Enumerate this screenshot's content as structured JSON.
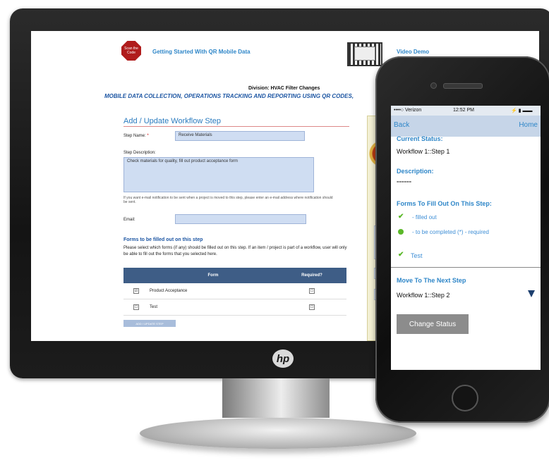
{
  "desktop": {
    "header": {
      "logo_text": "Scan the Code",
      "getting_started_link": "Getting Started With QR Mobile Data",
      "video_demo_link": "Video Demo"
    },
    "division": "Division: HVAC Filter Changes",
    "tagline": "MOBILE DATA COLLECTION, OPERATIONS TRACKING AND REPORTING USING QR CODES,",
    "section_title": "Add / Update Workflow Step",
    "step_name": {
      "label": "Step Name:",
      "required_mark": "*",
      "value": "Receive Materials"
    },
    "step_description": {
      "label": "Step Description:",
      "value": "Check materials for quality, fill out product acceptance form"
    },
    "email_note": "If you want e-mail notification to be sent when a project is moved to this step, please enter an e-mail address where notification should be sent.",
    "email": {
      "label": "Email:",
      "value": ""
    },
    "forms_heading": "Forms to be filled out on this step",
    "forms_instructions": "Please select which forms (if any) should be filled out on this step. If an item / project is part of a workflow, user will only be able to fill out the forms that you selected here.",
    "forms_table": {
      "headers": [
        "",
        "Form",
        "Required?"
      ],
      "rows": [
        {
          "selected": "☑",
          "form": "Product Acceptance",
          "required": "☐"
        },
        {
          "selected": "☐",
          "form": "Test",
          "required": "☐"
        }
      ]
    },
    "add_button": "ADD / UPDATE STEP",
    "monitor_logo": "hp"
  },
  "phone": {
    "status_bar": {
      "carrier": "••••○ Verizon",
      "time": "12:52 PM",
      "battery": "⚡ ▮ ▬▬"
    },
    "nav": {
      "back": "Back",
      "home": "Home"
    },
    "current_status_label": "Current Status:",
    "current_status_value": "Workflow 1::Step 1",
    "description_label": "Description:",
    "description_value": "======",
    "forms_label": "Forms To Fill Out On This Step:",
    "legend": {
      "filled": "- filled out",
      "to_complete": "- to be completed    (*) - required"
    },
    "forms": [
      {
        "name": "Test",
        "status": "filled"
      }
    ],
    "move_label": "Move To The Next Step",
    "next_step_value": "Workflow 1::Step 2",
    "change_status_button": "Change Status"
  },
  "colors": {
    "accent_blue": "#2e86c8",
    "table_header": "#3e5d86",
    "check_green": "#5ab828",
    "button_gray": "#8c8c8c"
  }
}
